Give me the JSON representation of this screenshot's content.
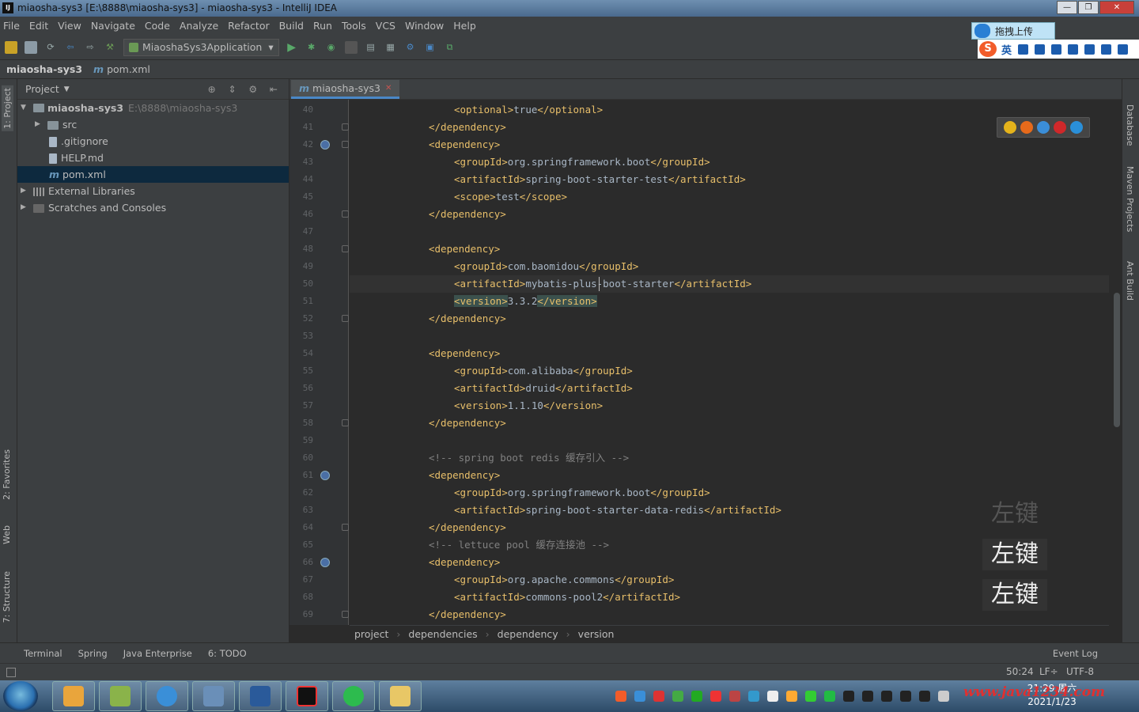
{
  "window": {
    "title": "miaosha-sys3 [E:\\8888\\miaosha-sys3] - miaosha-sys3 - IntelliJ IDEA"
  },
  "menu": [
    "File",
    "Edit",
    "View",
    "Navigate",
    "Code",
    "Analyze",
    "Refactor",
    "Build",
    "Run",
    "Tools",
    "VCS",
    "Window",
    "Help"
  ],
  "toolbar": {
    "run_config": "MiaoshaSys3Application"
  },
  "breadcrumb": {
    "project": "miaosha-sys3",
    "file": "pom.xml"
  },
  "left_tabs": {
    "project": "1: Project",
    "favorites": "2: Favorites",
    "web": "Web",
    "structure": "7: Structure"
  },
  "right_tabs": {
    "database": "Database",
    "maven": "Maven Projects",
    "ant": "Ant Build"
  },
  "project_panel": {
    "title": "Project",
    "tree": [
      {
        "label": "miaosha-sys3",
        "path": "E:\\8888\\miaosha-sys3"
      },
      {
        "label": "src"
      },
      {
        "label": ".gitignore"
      },
      {
        "label": "HELP.md"
      },
      {
        "label": "pom.xml"
      },
      {
        "label": "External Libraries"
      },
      {
        "label": "Scratches and Consoles"
      }
    ]
  },
  "editor": {
    "tab": "miaosha-sys3",
    "caret": "50:24",
    "lines": [
      {
        "n": "40",
        "indent": 4,
        "parts": [
          [
            "t",
            "<optional>"
          ],
          [
            "v",
            "true"
          ],
          [
            "t",
            "</optional>"
          ]
        ]
      },
      {
        "n": "41",
        "indent": 2,
        "parts": [
          [
            "t",
            "</dependency>"
          ]
        ]
      },
      {
        "n": "42",
        "indent": 2,
        "parts": [
          [
            "t",
            "<dependency>"
          ]
        ]
      },
      {
        "n": "43",
        "indent": 4,
        "parts": [
          [
            "t",
            "<groupId>"
          ],
          [
            "v",
            "org.springframework.boot"
          ],
          [
            "t",
            "</groupId>"
          ]
        ]
      },
      {
        "n": "44",
        "indent": 4,
        "parts": [
          [
            "t",
            "<artifactId>"
          ],
          [
            "v",
            "spring-boot-starter-test"
          ],
          [
            "t",
            "</artifactId>"
          ]
        ]
      },
      {
        "n": "45",
        "indent": 4,
        "parts": [
          [
            "t",
            "<scope>"
          ],
          [
            "v",
            "test"
          ],
          [
            "t",
            "</scope>"
          ]
        ]
      },
      {
        "n": "46",
        "indent": 2,
        "parts": [
          [
            "t",
            "</dependency>"
          ]
        ]
      },
      {
        "n": "47",
        "indent": 0,
        "parts": []
      },
      {
        "n": "48",
        "indent": 2,
        "parts": [
          [
            "t",
            "<dependency>"
          ]
        ]
      },
      {
        "n": "49",
        "indent": 4,
        "parts": [
          [
            "t",
            "<groupId>"
          ],
          [
            "v",
            "com.baomidou"
          ],
          [
            "t",
            "</groupId>"
          ]
        ]
      },
      {
        "n": "50",
        "indent": 4,
        "parts": [
          [
            "t",
            "<artifactId>"
          ],
          [
            "v",
            "mybatis-plus-boot-starter"
          ],
          [
            "t",
            "</artifactId>"
          ]
        ]
      },
      {
        "n": "51",
        "indent": 4,
        "parts": [
          [
            "th",
            "<version>"
          ],
          [
            "v",
            "3.3.2"
          ],
          [
            "th",
            "</version>"
          ]
        ]
      },
      {
        "n": "52",
        "indent": 2,
        "parts": [
          [
            "t",
            "</dependency>"
          ]
        ]
      },
      {
        "n": "53",
        "indent": 0,
        "parts": []
      },
      {
        "n": "54",
        "indent": 2,
        "parts": [
          [
            "t",
            "<dependency>"
          ]
        ]
      },
      {
        "n": "55",
        "indent": 4,
        "parts": [
          [
            "t",
            "<groupId>"
          ],
          [
            "v",
            "com.alibaba"
          ],
          [
            "t",
            "</groupId>"
          ]
        ]
      },
      {
        "n": "56",
        "indent": 4,
        "parts": [
          [
            "t",
            "<artifactId>"
          ],
          [
            "v",
            "druid"
          ],
          [
            "t",
            "</artifactId>"
          ]
        ]
      },
      {
        "n": "57",
        "indent": 4,
        "parts": [
          [
            "t",
            "<version>"
          ],
          [
            "v",
            "1.1.10"
          ],
          [
            "t",
            "</version>"
          ]
        ]
      },
      {
        "n": "58",
        "indent": 2,
        "parts": [
          [
            "t",
            "</dependency>"
          ]
        ]
      },
      {
        "n": "59",
        "indent": 0,
        "parts": []
      },
      {
        "n": "60",
        "indent": 2,
        "parts": [
          [
            "c",
            "<!-- spring boot redis 缓存引入 -->"
          ]
        ]
      },
      {
        "n": "61",
        "indent": 2,
        "parts": [
          [
            "t",
            "<dependency>"
          ]
        ]
      },
      {
        "n": "62",
        "indent": 4,
        "parts": [
          [
            "t",
            "<groupId>"
          ],
          [
            "v",
            "org.springframework.boot"
          ],
          [
            "t",
            "</groupId>"
          ]
        ]
      },
      {
        "n": "63",
        "indent": 4,
        "parts": [
          [
            "t",
            "<artifactId>"
          ],
          [
            "v",
            "spring-boot-starter-data-redis"
          ],
          [
            "t",
            "</artifactId>"
          ]
        ]
      },
      {
        "n": "64",
        "indent": 2,
        "parts": [
          [
            "t",
            "</dependency>"
          ]
        ]
      },
      {
        "n": "65",
        "indent": 2,
        "parts": [
          [
            "c",
            "<!-- lettuce pool 缓存连接池 -->"
          ]
        ]
      },
      {
        "n": "66",
        "indent": 2,
        "parts": [
          [
            "t",
            "<dependency>"
          ]
        ]
      },
      {
        "n": "67",
        "indent": 4,
        "parts": [
          [
            "t",
            "<groupId>"
          ],
          [
            "v",
            "org.apache.commons"
          ],
          [
            "t",
            "</groupId>"
          ]
        ]
      },
      {
        "n": "68",
        "indent": 4,
        "parts": [
          [
            "t",
            "<artifactId>"
          ],
          [
            "v",
            "commons-pool2"
          ],
          [
            "t",
            "</artifactId>"
          ]
        ]
      },
      {
        "n": "69",
        "indent": 2,
        "parts": [
          [
            "t",
            "</dependency>"
          ]
        ]
      }
    ],
    "crumbs": [
      "project",
      "dependencies",
      "dependency",
      "version"
    ]
  },
  "overlays": {
    "key_hints": [
      "左键",
      "左键",
      "左键"
    ],
    "ime_upload": "拖拽上传",
    "ime_lang": "英"
  },
  "tool_windows": {
    "items": [
      "Terminal",
      "Spring",
      "Java Enterprise",
      "6: TODO"
    ],
    "event_log": "Event Log"
  },
  "status": {
    "position": "50:24",
    "line_sep": "LF÷",
    "encoding": "UTF-8"
  },
  "clock": {
    "time": "21:29 周六",
    "date": "2021/1/23"
  },
  "watermark": "www.java1234.com"
}
